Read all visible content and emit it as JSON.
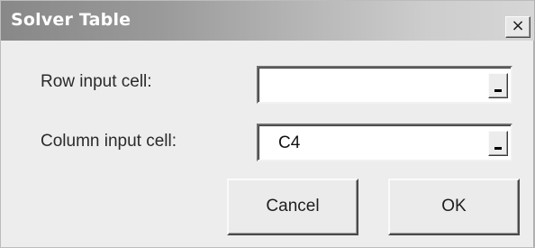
{
  "dialog": {
    "title": "Solver Table",
    "close_glyph": "×",
    "close_icon": "close-icon"
  },
  "row_input": {
    "label": "Row input cell:",
    "value": ""
  },
  "column_input": {
    "label": "Column input cell:",
    "value": "C4"
  },
  "buttons": {
    "cancel": "Cancel",
    "ok": "OK"
  }
}
